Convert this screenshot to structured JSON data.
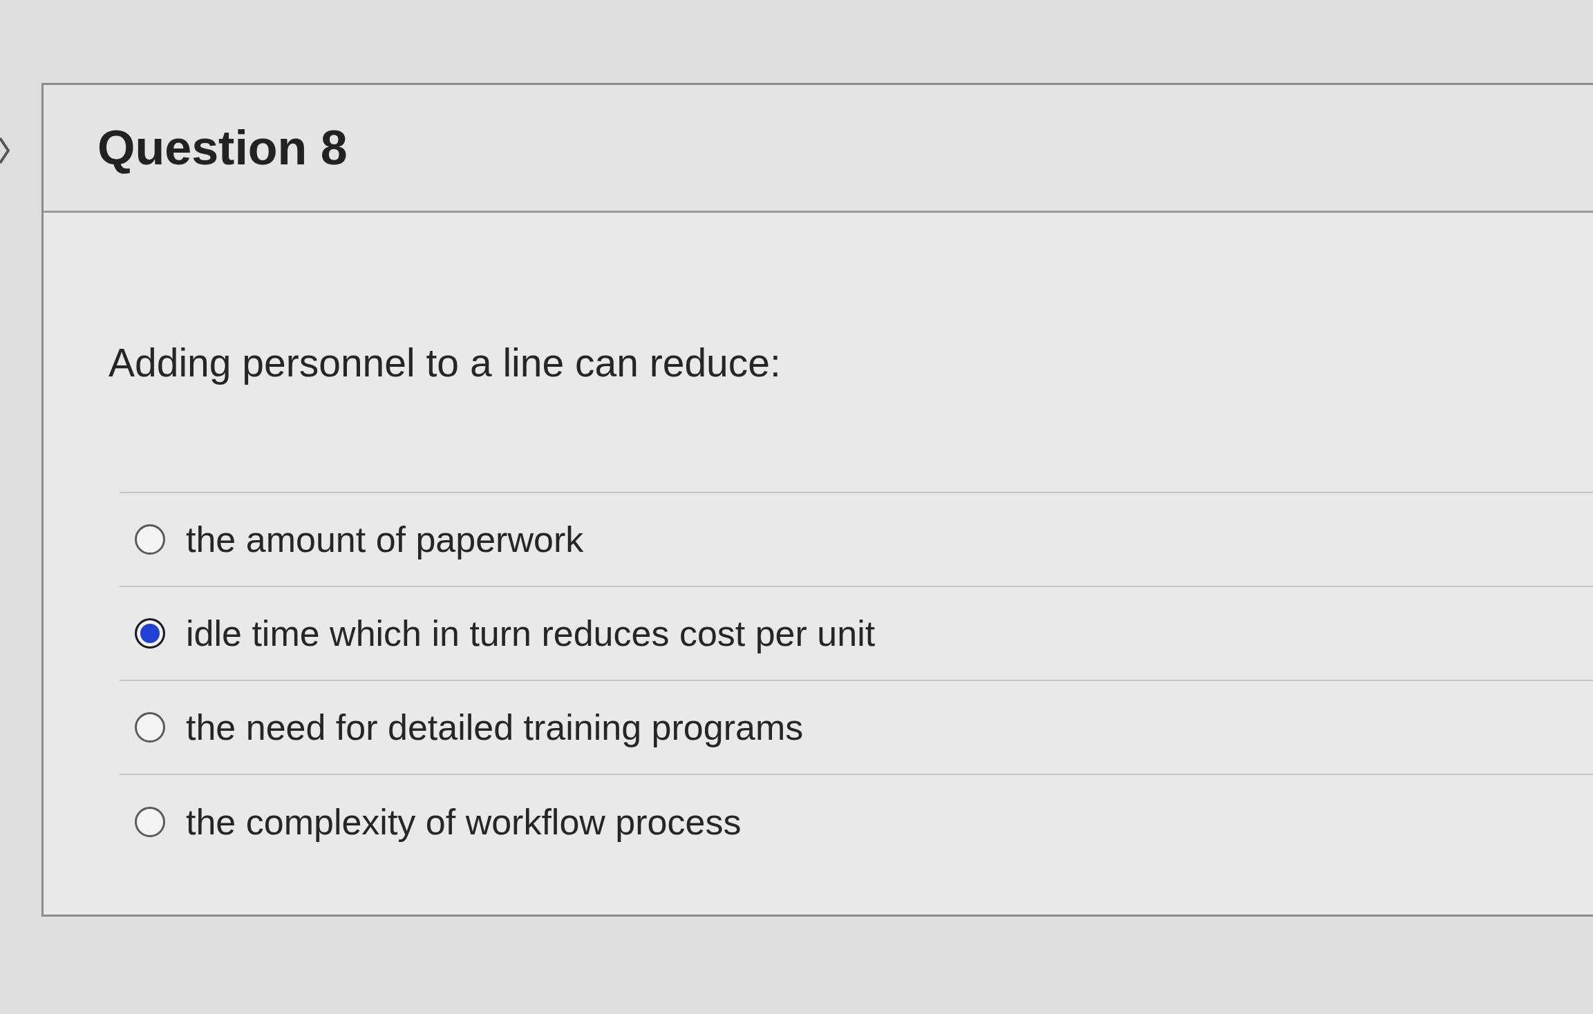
{
  "question": {
    "title": "Question 8",
    "prompt": "Adding personnel to a line can reduce:",
    "options": [
      {
        "label": "the amount of paperwork",
        "selected": false
      },
      {
        "label": "idle time which in turn reduces cost per unit",
        "selected": true
      },
      {
        "label": "the need for detailed training programs",
        "selected": false
      },
      {
        "label": "the complexity of workflow process",
        "selected": false
      }
    ]
  }
}
